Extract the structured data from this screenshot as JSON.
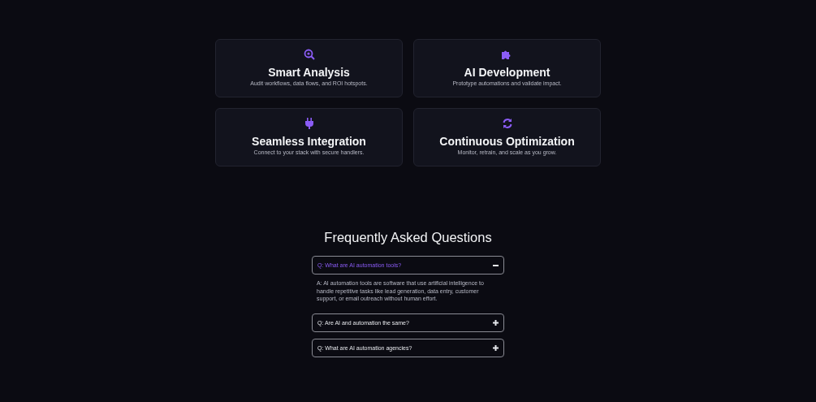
{
  "features": [
    {
      "kind": "search",
      "title": "Smart Analysis",
      "description": "Audit workflows, data flows, and ROI hotspots."
    },
    {
      "kind": "puzzle",
      "title": "AI Development",
      "description": "Prototype automations and validate impact."
    },
    {
      "kind": "plug",
      "title": "Seamless Integration",
      "description": "Connect to your stack with secure handlers."
    },
    {
      "kind": "sync",
      "title": "Continuous Optimization",
      "description": "Monitor, retrain, and scale as you grow."
    }
  ],
  "faq": {
    "title": "Frequently Asked Questions",
    "items": [
      {
        "question": "Q: What are AI automation tools?",
        "expanded": true,
        "answer": "A: AI automation tools are software that use artificial intelligence to handle repetitive tasks like lead generation, data entry, customer support, or email outreach without human effort."
      },
      {
        "question": "Q: Are AI and automation the same?",
        "expanded": false
      },
      {
        "question": "Q: What are AI automation agencies?",
        "expanded": false
      }
    ]
  }
}
